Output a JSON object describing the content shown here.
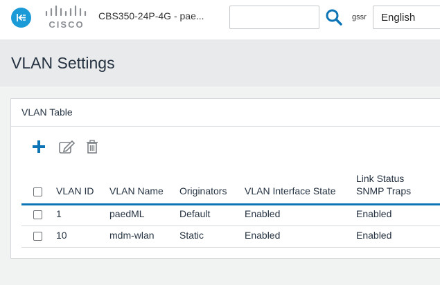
{
  "header": {
    "device_name": "CBS350-24P-4G - pae...",
    "logo_text": "CISCO",
    "search_value": "",
    "username": "gssr",
    "language": "English"
  },
  "icons": {
    "menu": "menu-collapse-icon",
    "logo": "cisco-bridge-logo",
    "search": "search-icon",
    "add": "plus-icon",
    "edit": "edit-icon",
    "delete": "trash-icon"
  },
  "colors": {
    "accent": "#1a9bd7",
    "table_header_rule": "#0d74b5",
    "add_icon": "#0d74b5"
  },
  "page": {
    "title": "VLAN Settings"
  },
  "vlan_table": {
    "title": "VLAN Table",
    "columns": {
      "vlan_id": "VLAN ID",
      "vlan_name": "VLAN Name",
      "originators": "Originators",
      "interface_state": "VLAN Interface State",
      "link_status_line1": "Link Status",
      "link_status_line2": "SNMP Traps"
    },
    "rows": [
      {
        "vlan_id": "1",
        "vlan_name": "paedML",
        "originators": "Default",
        "interface_state": "Enabled",
        "link_status": "Enabled"
      },
      {
        "vlan_id": "10",
        "vlan_name": "mdm-wlan",
        "originators": "Static",
        "interface_state": "Enabled",
        "link_status": "Enabled"
      }
    ]
  }
}
